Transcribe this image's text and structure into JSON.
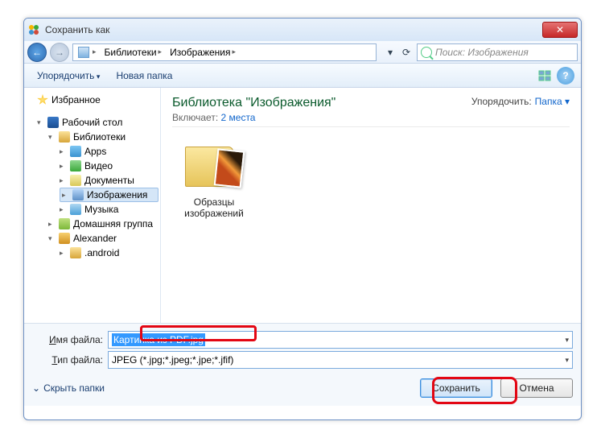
{
  "window": {
    "title": "Сохранить как"
  },
  "breadcrumb": {
    "lib": "Библиотеки",
    "pic": "Изображения"
  },
  "nav_tools": {
    "down": "▾",
    "refresh": "⟳"
  },
  "search": {
    "placeholder": "Поиск: Изображения"
  },
  "toolbar": {
    "organize": "Упорядочить",
    "newfolder": "Новая папка"
  },
  "tree": {
    "favorites": "Избранное",
    "desktop": "Рабочий стол",
    "libraries": "Библиотеки",
    "apps": "Apps",
    "video": "Видео",
    "documents": "Документы",
    "images": "Изображения",
    "music": "Музыка",
    "homegroup": "Домашняя группа",
    "user": "Alexander",
    "android": ".android"
  },
  "content": {
    "title": "Библиотека \"Изображения\"",
    "includes_label": "Включает:",
    "includes_count": "2 места",
    "arrange_label": "Упорядочить:",
    "arrange_value": "Папка",
    "item1": "Образцы изображений"
  },
  "fields": {
    "filename_label_u": "И",
    "filename_label_rest": "мя файла:",
    "filetype_label_u": "Т",
    "filetype_label_rest": "ип файла:",
    "filename_value": "Картинка из PDF.jpg",
    "filetype_value": "JPEG (*.jpg;*.jpeg;*.jpe;*.jfif)"
  },
  "footer": {
    "hidefolders": "Скрыть папки",
    "save": "Сохранить",
    "cancel": "Отмена",
    "chevron": "⌄"
  },
  "help": "?"
}
